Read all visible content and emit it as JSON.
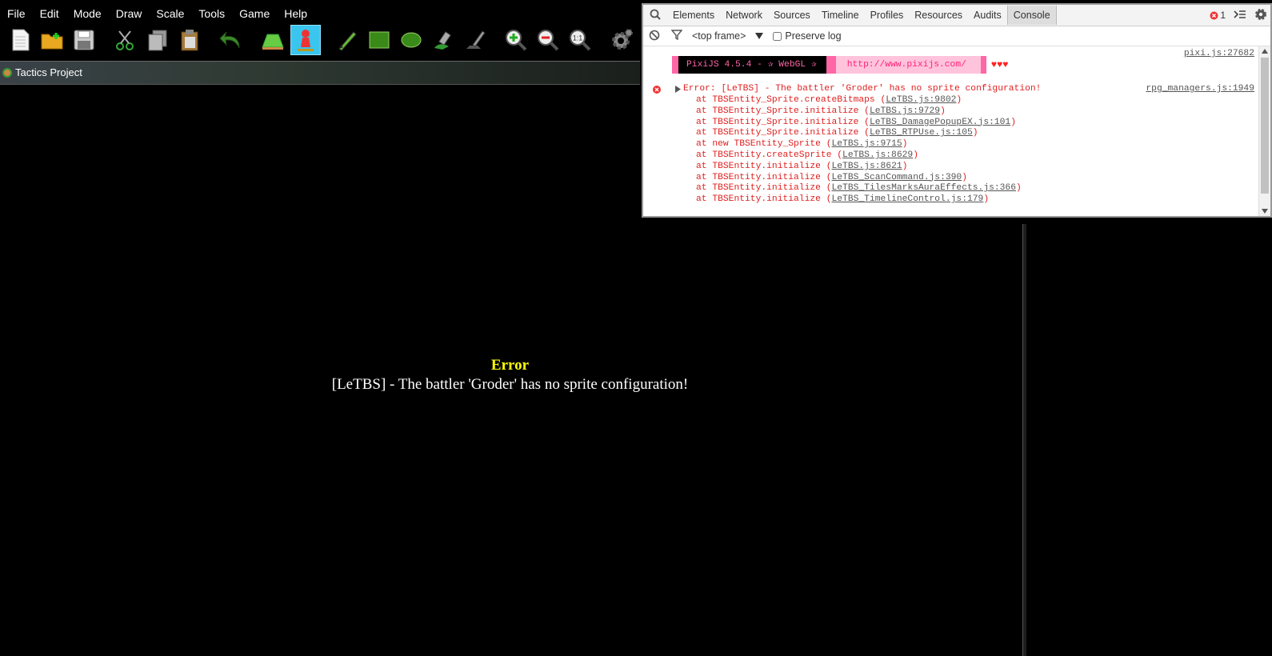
{
  "menu": [
    "File",
    "Edit",
    "Mode",
    "Draw",
    "Scale",
    "Tools",
    "Game",
    "Help"
  ],
  "toolbar": {
    "icons": [
      "new-file-icon",
      "open-folder-icon",
      "save-icon",
      "cut-icon",
      "copy-icon",
      "paste-icon",
      "undo-icon",
      "map-mode-icon",
      "event-mode-icon",
      "pencil-icon",
      "rectangle-icon",
      "ellipse-icon",
      "flood-fill-icon",
      "shadow-pen-icon",
      "zoom-in-icon",
      "zoom-out-icon",
      "zoom-actual-icon",
      "settings-gear-icon"
    ],
    "zoom_actual_label": "1:1",
    "active_tool": "event-mode-icon"
  },
  "project_tab": {
    "label": "Tactics Project"
  },
  "game": {
    "error_title": "Error",
    "error_message": "[LeTBS] - The battler 'Groder' has no sprite configuration!"
  },
  "devtools": {
    "tabs": [
      "Elements",
      "Network",
      "Sources",
      "Timeline",
      "Profiles",
      "Resources",
      "Audits",
      "Console"
    ],
    "selected_tab": "Console",
    "error_count": "1",
    "frame_select": "<top frame>",
    "preserve_log_label": "Preserve log",
    "preserve_log_checked": false,
    "pixi": {
      "banner_text": "PixiJS 4.5.4 - ✰ WebGL ✰",
      "url": "http://www.pixijs.com/",
      "hearts": "♥♥♥",
      "source": "pixi.js:27682"
    },
    "error": {
      "message": "Error: [LeTBS] - The battler 'Groder' has no sprite configuration!",
      "source": "rpg_managers.js:1949",
      "stack": [
        {
          "fn": "at TBSEntity_Sprite.createBitmaps",
          "loc": "LeTBS.js:9802"
        },
        {
          "fn": "at TBSEntity_Sprite.initialize",
          "loc": "LeTBS.js:9729"
        },
        {
          "fn": "at TBSEntity_Sprite.initialize",
          "loc": "LeTBS_DamagePopupEX.js:101"
        },
        {
          "fn": "at TBSEntity_Sprite.initialize",
          "loc": "LeTBS_RTPUse.js:105"
        },
        {
          "fn": "at new TBSEntity_Sprite",
          "loc": "LeTBS.js:9715"
        },
        {
          "fn": "at TBSEntity.createSprite",
          "loc": "LeTBS.js:8629"
        },
        {
          "fn": "at TBSEntity.initialize",
          "loc": "LeTBS.js:8621"
        },
        {
          "fn": "at TBSEntity.initialize",
          "loc": "LeTBS_ScanCommand.js:390"
        },
        {
          "fn": "at TBSEntity.initialize",
          "loc": "LeTBS_TilesMarksAuraEffects.js:366"
        },
        {
          "fn": "at TBSEntity.initialize",
          "loc": "LeTBS_TimelineControl.js:179"
        }
      ]
    }
  }
}
